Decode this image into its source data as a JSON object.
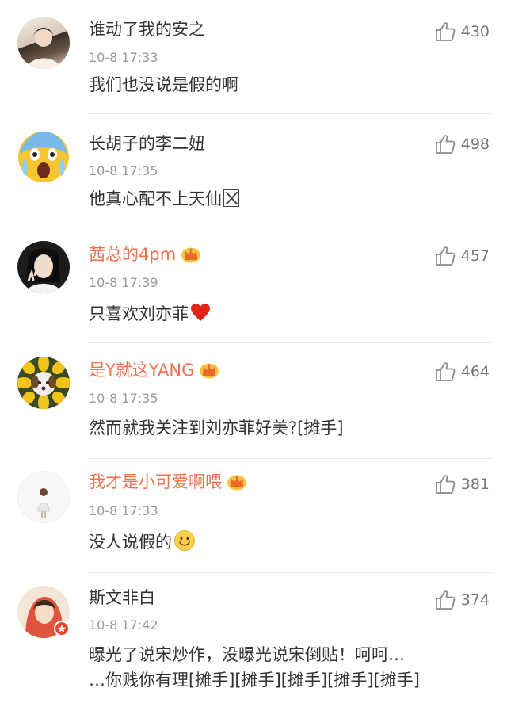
{
  "comments": [
    {
      "username": "谁动了我的安之",
      "time": "10-8 17:33",
      "text": "我们也没说是假的啊",
      "likes": "430",
      "vip": false,
      "avatar_color": "#d9c9b8"
    },
    {
      "username": "长胡子的李二妞",
      "time": "10-8 17:35",
      "text": "他真心配不上天仙",
      "likes": "498",
      "vip": false,
      "avatar_icon": "screaming-face-emoji"
    },
    {
      "username": "茜总的4pm",
      "time": "10-8 17:39",
      "text": "只喜欢刘亦菲",
      "likes": "457",
      "vip": true,
      "avatar_color": "#2b2b2b"
    },
    {
      "username": "是Y就这YANG",
      "time": "10-8 17:35",
      "text": "然而就我关注到刘亦菲好美?[摊手]",
      "likes": "464",
      "vip": true,
      "avatar_color": "#e8b52b"
    },
    {
      "username": "我才是小可爱啊喂",
      "time": "10-8 17:33",
      "text": "没人说假的",
      "likes": "381",
      "vip": true,
      "avatar_color": "#f1f1f1"
    },
    {
      "username": "斯文非白",
      "time": "10-8 17:42",
      "text_line1": "曝光了说宋炒作，没曝光说宋倒贴！呵呵…",
      "text_line2": "…你贱你有理[摊手][摊手][摊手][摊手][摊手]",
      "likes": "374",
      "vip": false,
      "avatar_color": "#e35b4a"
    }
  ],
  "colors": {
    "vip_name": "#eb7350",
    "name": "#333333",
    "time": "#9a9a9a",
    "like_icon": "#8a8a8a"
  }
}
